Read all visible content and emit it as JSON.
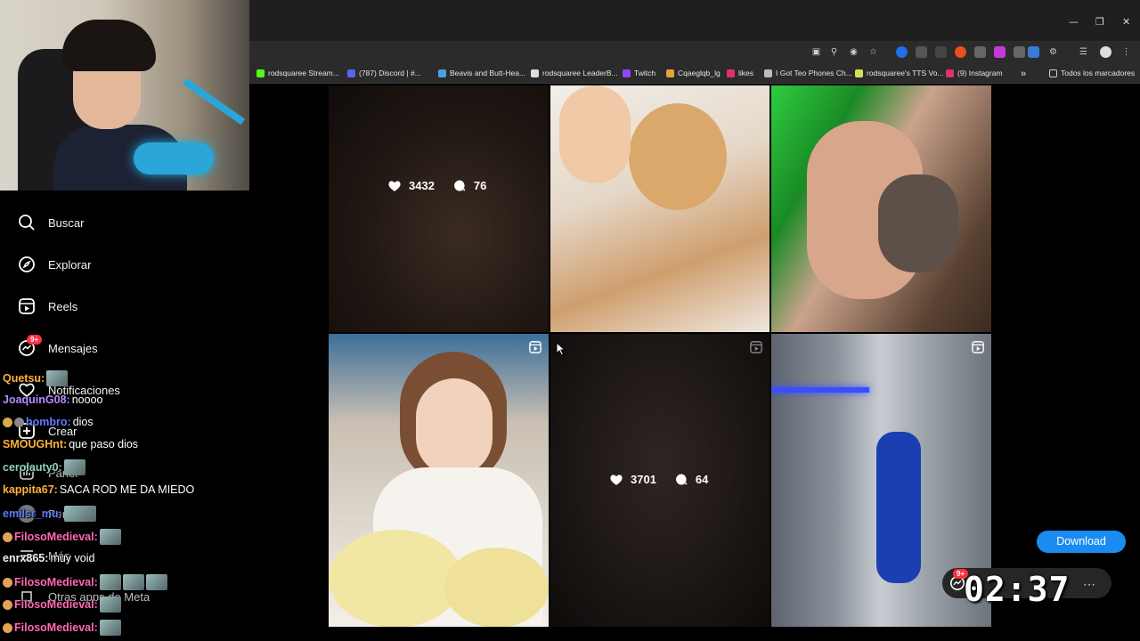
{
  "bookmarks": [
    {
      "label": "rodsquaree Stream...",
      "color": "#53fc18"
    },
    {
      "label": "(787) Discord | #...",
      "color": "#5865f2"
    },
    {
      "label": "Beavis and Butt-Hea...",
      "color": "#4aa3df"
    },
    {
      "label": "rodsquaree LeaderB...",
      "color": "#dddddd"
    },
    {
      "label": "Twitch",
      "color": "#9146ff"
    },
    {
      "label": "Cqaeglqb_lg",
      "color": "#e6a23c"
    },
    {
      "label": "likes",
      "color": "#e1306c"
    },
    {
      "label": "I Got Teo Phones Ch...",
      "color": "#bbbbbb"
    },
    {
      "label": "rodsquaree's TTS Vo...",
      "color": "#d4e157"
    },
    {
      "label": "(9) Instagram",
      "color": "#e1306c"
    }
  ],
  "bookmarks_more": "»",
  "all_bookmarks": "Todos los marcadores",
  "nav": {
    "search": "Buscar",
    "explore": "Explorar",
    "reels": "Reels",
    "messages": "Mensajes",
    "messages_badge": "9+",
    "notifications": "Notificaciones",
    "create": "Crear",
    "panel": "Panel",
    "profile": "Perfil",
    "more": "Más",
    "meta": "Otras apps de Meta"
  },
  "chat": [
    {
      "user": "Quetsu:",
      "color": "#ffb13b",
      "text": "",
      "emote": true
    },
    {
      "user": "JoaquinG08:",
      "color": "#b58cff",
      "text": " noooo"
    },
    {
      "user": "hombro:",
      "color": "#5c7cff",
      "text": " dios",
      "badge": true
    },
    {
      "user": "SMOUGHnt:",
      "color": "#ffb13b",
      "text": " que paso dios"
    },
    {
      "user": "cerolauty0:",
      "color": "#8fd0c4",
      "text": "",
      "emote": true
    },
    {
      "user": "kappita67:",
      "color": "#ffb13b",
      "text": " SACA ROD ME DA MIEDO"
    },
    {
      "user": "emilsr_mu:",
      "color": "#5c7cff",
      "text": "",
      "emote": true
    },
    {
      "user": "FilosoMedieval:",
      "color": "#ff69b4",
      "text": "",
      "emote": true,
      "badge": true
    },
    {
      "user": "enrx865:",
      "color": "#eeeeee",
      "text": " muy void"
    },
    {
      "user": "FilosoMedieval:",
      "color": "#ff69b4",
      "text": "",
      "emote": true,
      "badge": true
    },
    {
      "user": "FilosoMedieval:",
      "color": "#ff69b4",
      "text": "",
      "emote": true,
      "badge": true
    },
    {
      "user": "FilosoMedieval:",
      "color": "#ff69b4",
      "text": "",
      "emote": true,
      "badge": true
    }
  ],
  "tiles": [
    {
      "likes": "3432",
      "comments": "76",
      "hover": true
    },
    {
      "likes": "",
      "comments": ""
    },
    {
      "likes": "",
      "comments": ""
    },
    {
      "likes": "",
      "comments": "",
      "reel": true
    },
    {
      "likes": "3701",
      "comments": "64",
      "hover": true,
      "reel": true
    },
    {
      "likes": "",
      "comments": "",
      "reel": true
    }
  ],
  "download_label": "Download",
  "messages_pill_badge": "9+",
  "timer": "02:37"
}
